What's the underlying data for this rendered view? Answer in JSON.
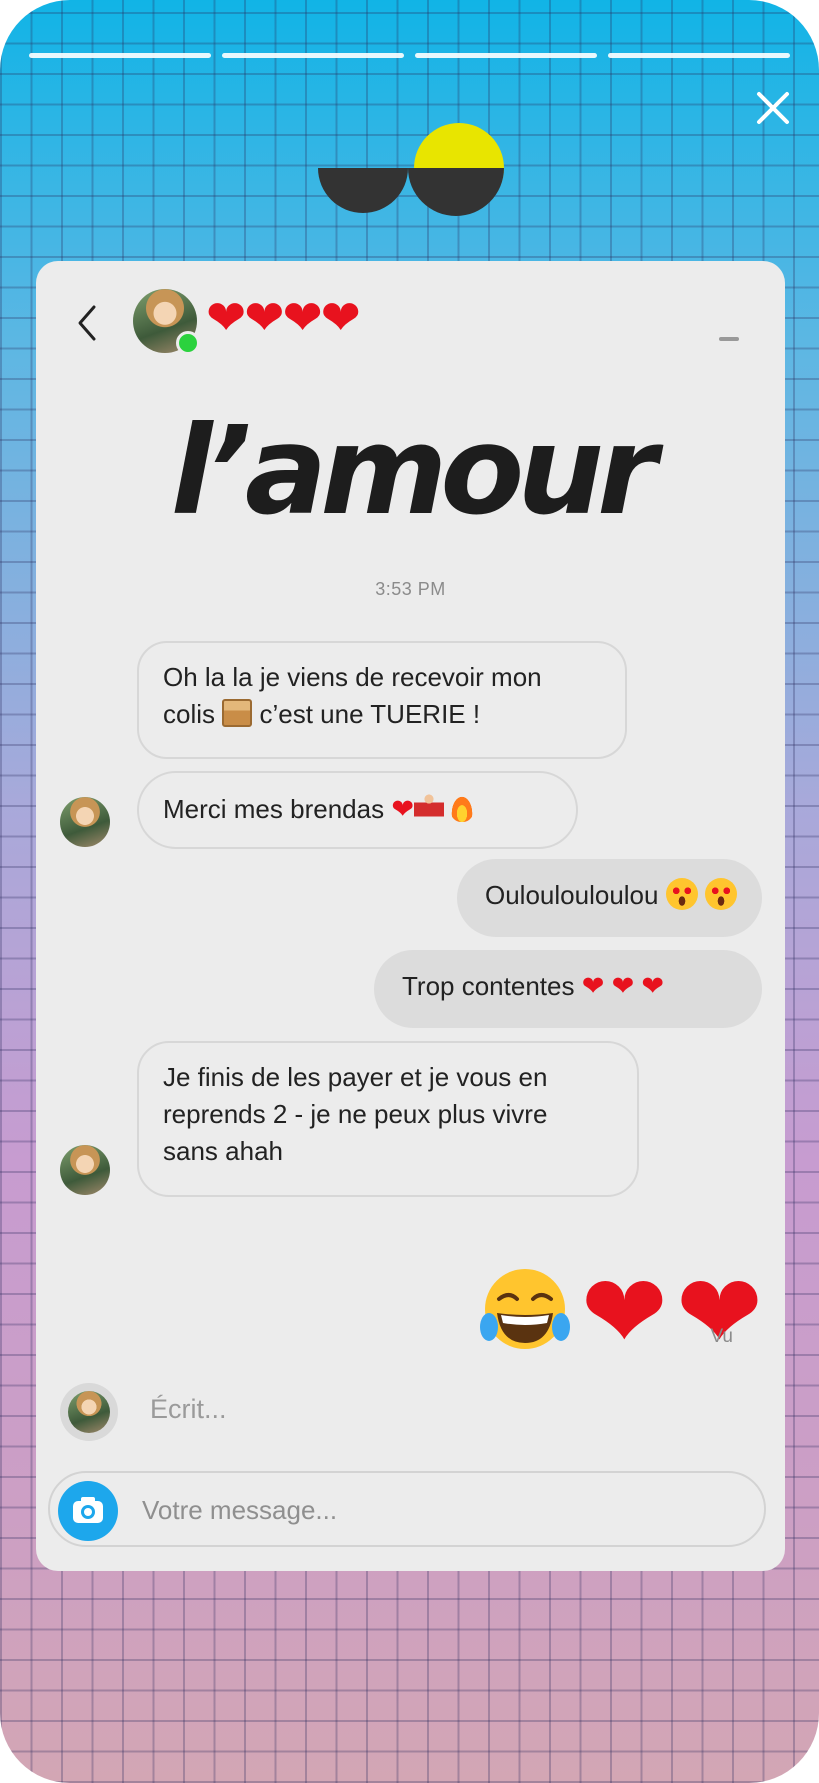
{
  "story": {
    "progress_segments": 4,
    "close_icon": "close-icon",
    "accent_blue": "#11b4e6",
    "accent_pink": "#cc9fc4"
  },
  "logo": {
    "left_color": "#333333",
    "right_color": "#e8e500"
  },
  "chat": {
    "header": {
      "back_icon": "chevron-left-icon",
      "title": "❤❤❤❤",
      "online": true
    },
    "headline": "l’amour",
    "timestamp": "3:53 PM",
    "messages": [
      {
        "direction": "in",
        "text_line1": "Oh la la je viens de recevoir mon",
        "text_line2_before": "colis",
        "emoji": "package-emoji",
        "text_line2_after": "c’est une TUERIE !"
      },
      {
        "direction": "in",
        "text": "Merci mes brendas",
        "emojis": [
          "heart-emoji",
          "dancer-emoji",
          "fire-emoji"
        ]
      },
      {
        "direction": "out",
        "text": "Ouloulouloulou",
        "emojis": [
          "heart-eyes-emoji",
          "heart-eyes-emoji"
        ]
      },
      {
        "direction": "out",
        "text": "Trop contentes",
        "emojis": [
          "heart-emoji",
          "heart-emoji",
          "heart-emoji"
        ]
      },
      {
        "direction": "in",
        "text_line1": "Je finis de les payer et je vous en",
        "text_line2": "reprends 2 - je ne peux plus vivre",
        "text_line3": "sans ahah"
      },
      {
        "direction": "out",
        "emojis": [
          "tears-of-joy-emoji",
          "heart-emoji",
          "heart-emoji"
        ]
      }
    ],
    "seen_label": "Vu",
    "typing_label": "Écrit...",
    "composer": {
      "placeholder": "Votre message...",
      "camera_icon": "camera-icon"
    }
  }
}
